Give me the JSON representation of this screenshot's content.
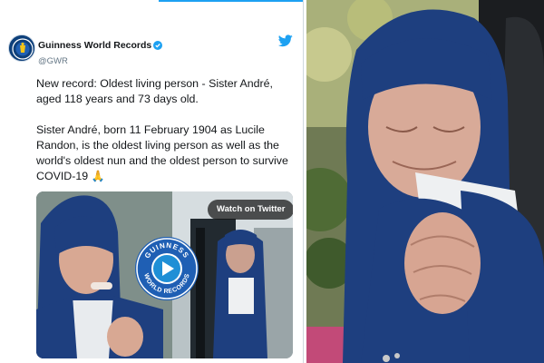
{
  "tweet": {
    "account": {
      "display_name": "Guinness World Records",
      "handle": "@GWR",
      "verified": true,
      "avatar_icon": "gwr-logo-icon",
      "platform_icon": "twitter-bird-icon"
    },
    "paragraph_1": "New record: Oldest living person - Sister André, aged 118 years and 73 days old.",
    "paragraph_2": "Sister André, born 11 February 1904 as Lucile Randon, is the oldest living person as well as the world's oldest nun and the oldest person to survive COVID-19",
    "emoji_icon": "folded-hands-icon",
    "video": {
      "watch_label": "Watch on Twitter",
      "play_icon": "play-icon",
      "badge_lettering": "GUINNESS WORLD RECORDS"
    }
  },
  "photo": {
    "subject_icon": "praying-nun-photo"
  },
  "colors": {
    "accent": "#1da1f2",
    "text": "#14171a",
    "muted": "#657786",
    "gwr_blue": "#1f5fb4",
    "habit_navy": "#1e3f7f"
  }
}
